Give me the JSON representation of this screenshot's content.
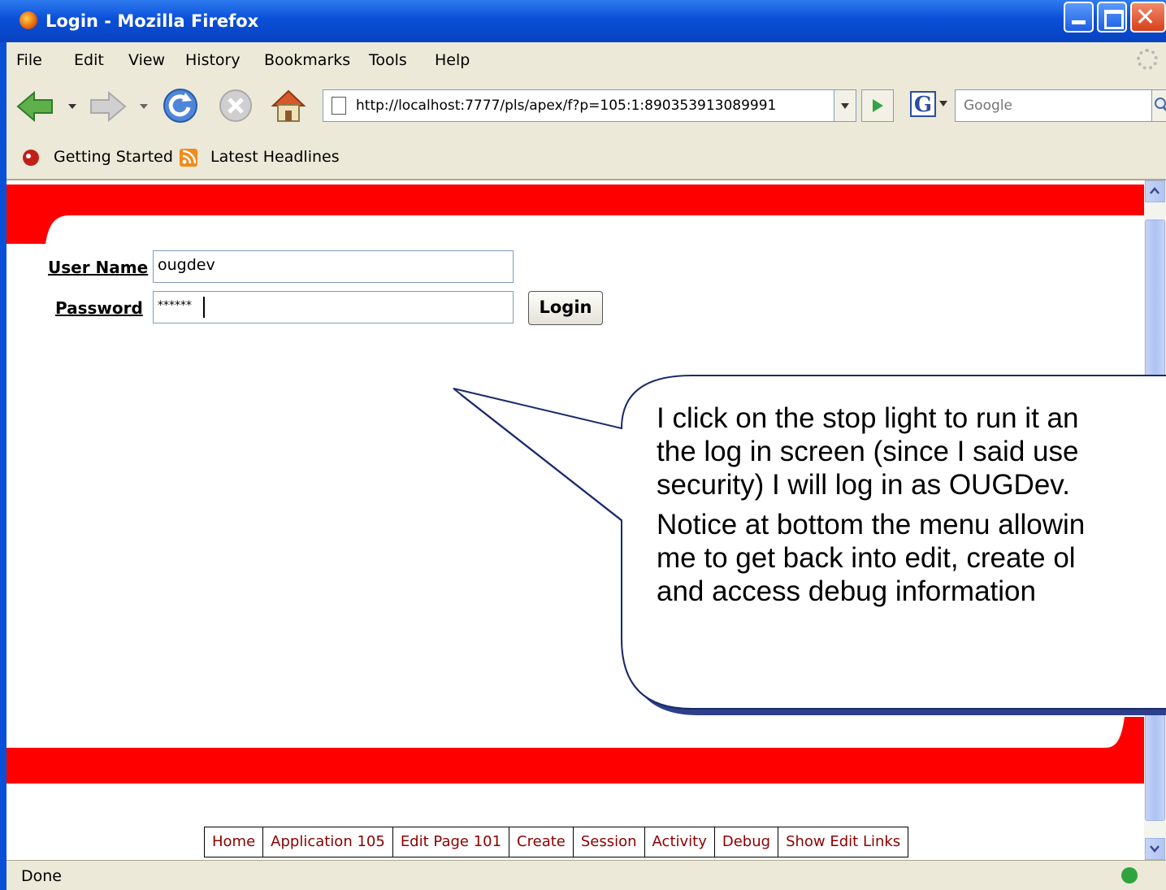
{
  "window": {
    "title": "Login - Mozilla Firefox"
  },
  "menu": [
    "File",
    "Edit",
    "View",
    "History",
    "Bookmarks",
    "Tools",
    "Help"
  ],
  "nav": {
    "url": "http://localhost:7777/pls/apex/f?p=105:1:890353913089991",
    "search_placeholder": "Google"
  },
  "bookmarks": [
    "Getting Started",
    "Latest Headlines"
  ],
  "form": {
    "username_label": "User Name",
    "username_value": "ougdev",
    "password_label": "Password",
    "password_value": "******",
    "login_label": "Login"
  },
  "devbar": [
    "Home",
    "Application 105",
    "Edit Page 101",
    "Create",
    "Session",
    "Activity",
    "Debug",
    "Show Edit Links"
  ],
  "status": {
    "text": "Done"
  },
  "callout": {
    "paragraph1": [
      "I click on the stop light to run it an",
      "the log in screen (since I said use",
      "security) I will log in as OUGDev."
    ],
    "paragraph2": [
      "Notice at bottom the menu allowin",
      "me to get back into edit, create ol",
      "and access debug information"
    ]
  },
  "colors": {
    "brand_red": "#ff0000",
    "xp_blue": "#0a4fd8",
    "chrome": "#ece9d8"
  }
}
